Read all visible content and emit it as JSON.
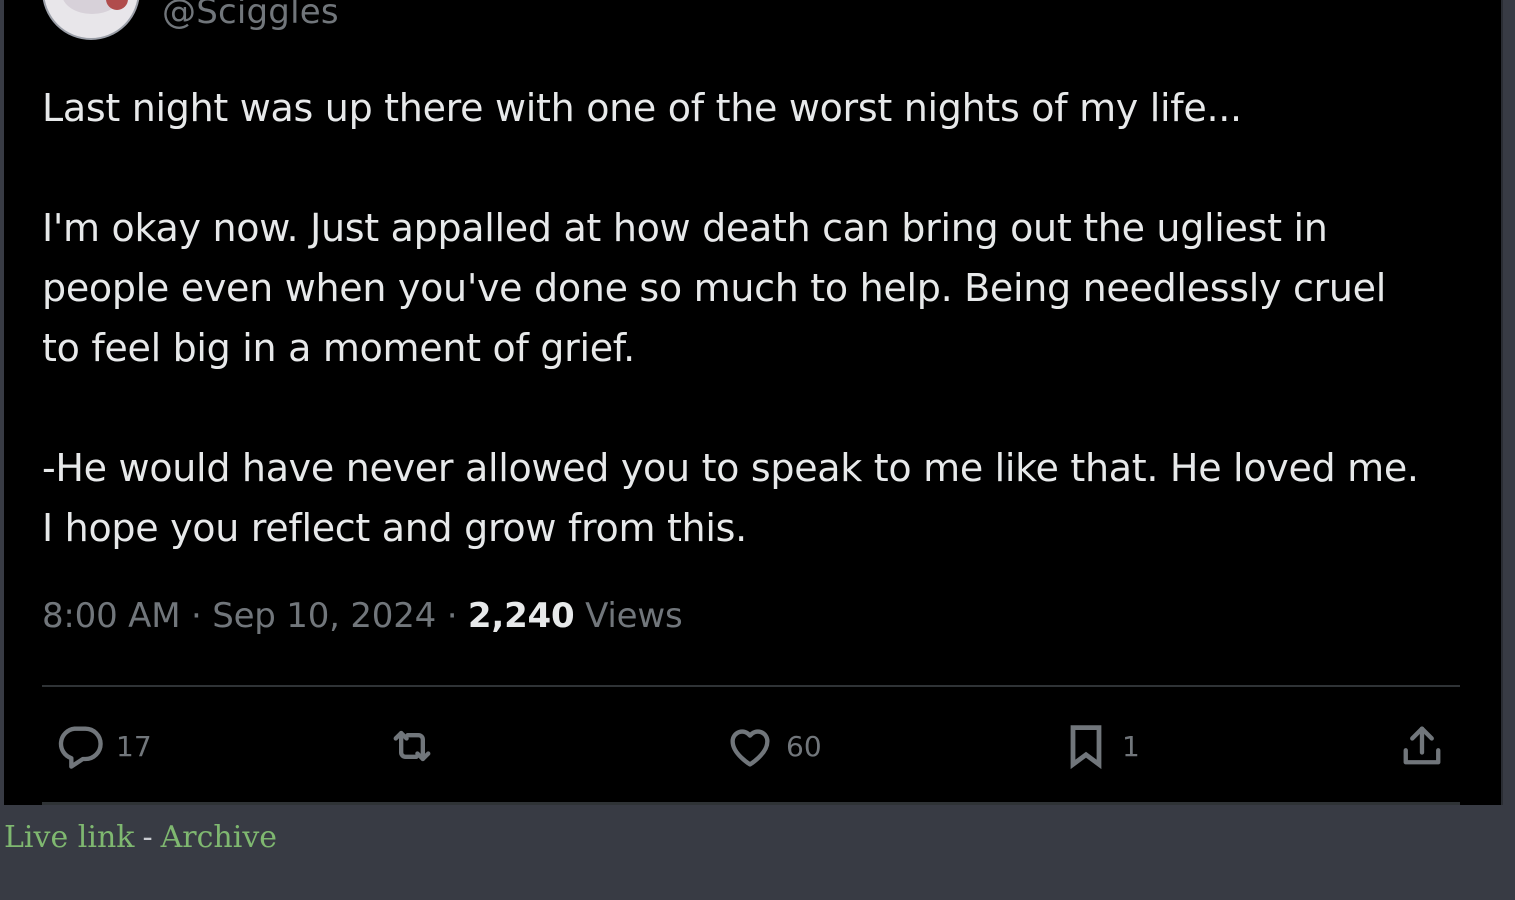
{
  "tweet": {
    "handle": "@Sciggles",
    "paragraphs": [
      [
        "Last night was up there with one of the worst nights of my life..."
      ],
      [
        "I'm okay now. Just appalled at how death can bring out the ugliest in",
        "people even when you've done so much to help. Being needlessly cruel",
        "to feel big in a moment of grief."
      ],
      [
        "-He would have never allowed you to speak to me like that. He loved me.",
        "I hope you reflect and grow from this."
      ]
    ],
    "time": "8:00 AM",
    "date": "Sep 10, 2024",
    "separator": " · ",
    "views_count": "2,240",
    "views_label": "Views",
    "actions": {
      "replies": "17",
      "retweets": "",
      "likes": "60",
      "bookmarks": "1"
    }
  },
  "footer": {
    "live_link": "Live link",
    "separator": "-",
    "archive": "Archive"
  },
  "colors": {
    "tweet_bg": "#000000",
    "page_bg": "#383b44",
    "text": "#e7e9ea",
    "muted": "#71767b",
    "link": "#7fb870"
  }
}
